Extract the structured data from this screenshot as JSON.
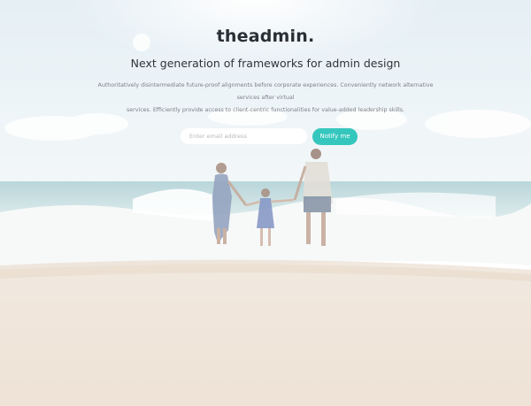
{
  "brand": {
    "logo": "theadmin."
  },
  "hero": {
    "headline": "Next generation of frameworks for admin design",
    "lead_line1": "Authoritatively disintermediate future-proof alignments before corporate experiences. Conveniently network alternative services after virtual",
    "lead_line2": "services. Efficiently provide access to client-centric functionalities for value-added leadership skills."
  },
  "subscribe": {
    "email_placeholder": "Enter email address",
    "email_value": "",
    "button_label": "Notify me"
  },
  "colors": {
    "accent": "#35c7bd",
    "text_dark": "#2b2f35",
    "text_muted": "#7b8087"
  }
}
